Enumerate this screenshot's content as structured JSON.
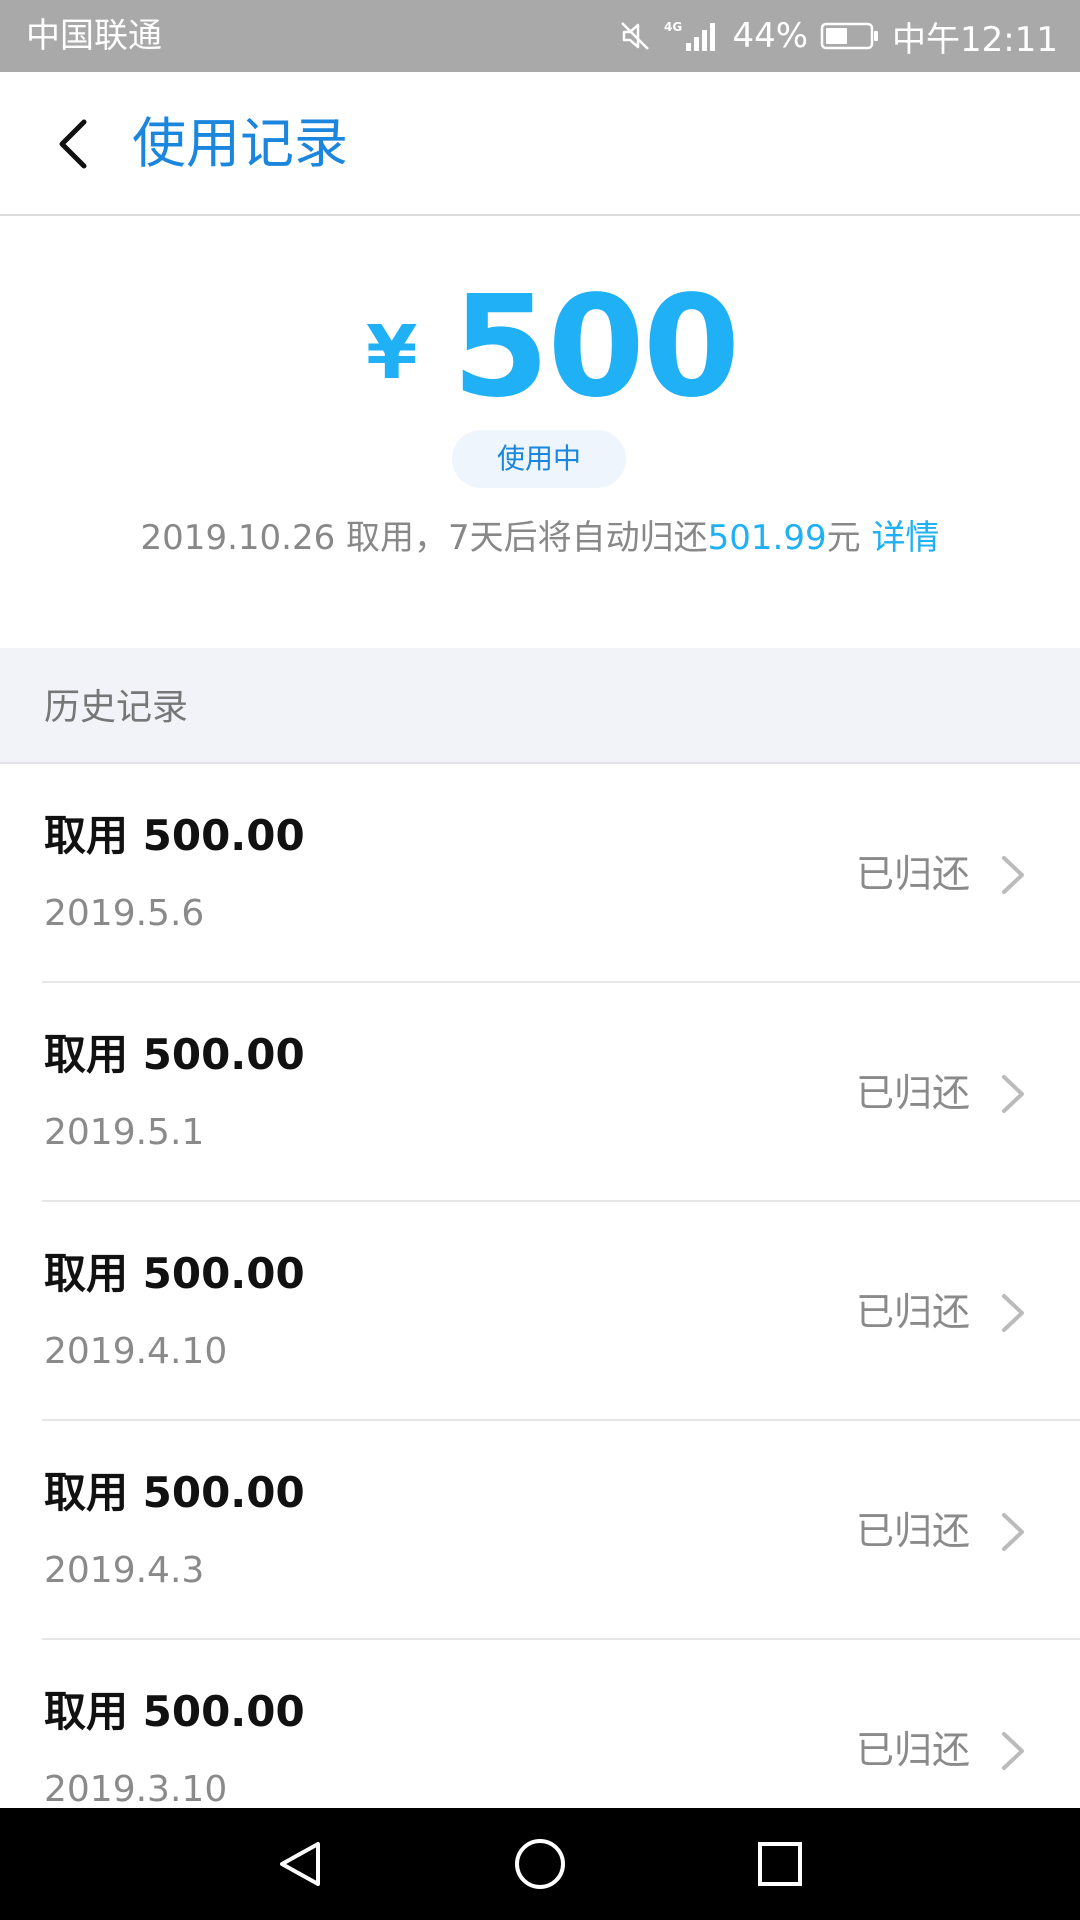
{
  "status_bar": {
    "carrier": "中国联通",
    "network": "4G",
    "battery": "44%",
    "time": "中午12:11",
    "icons": [
      "mute-icon",
      "signal-icon",
      "battery-icon"
    ]
  },
  "header": {
    "title": "使用记录",
    "back_icon": "back-arrow-icon"
  },
  "summary": {
    "currency_symbol": "¥",
    "amount": "500",
    "status": "使用中",
    "note_prefix": "2019.10.26 取用，7天后将自动归还",
    "note_amount": "501.99",
    "note_unit": "元",
    "details_link": "详情"
  },
  "history": {
    "title": "历史记录",
    "records": [
      {
        "title": "取用 500.00",
        "date": "2019.5.6",
        "status": "已归还"
      },
      {
        "title": "取用 500.00",
        "date": "2019.5.1",
        "status": "已归还"
      },
      {
        "title": "取用 500.00",
        "date": "2019.4.10",
        "status": "已归还"
      },
      {
        "title": "取用 500.00",
        "date": "2019.4.3",
        "status": "已归还"
      },
      {
        "title": "取用 500.00",
        "date": "2019.3.10",
        "status": "已归还"
      }
    ]
  },
  "nav_bar": {
    "icons": [
      "nav-back-icon",
      "nav-home-icon",
      "nav-recents-icon"
    ]
  },
  "colors": {
    "accent": "#1fb0f5",
    "title_blue": "#1a86dd",
    "status_bar_bg": "#a9a9a9",
    "section_bg": "#f2f3f8"
  }
}
